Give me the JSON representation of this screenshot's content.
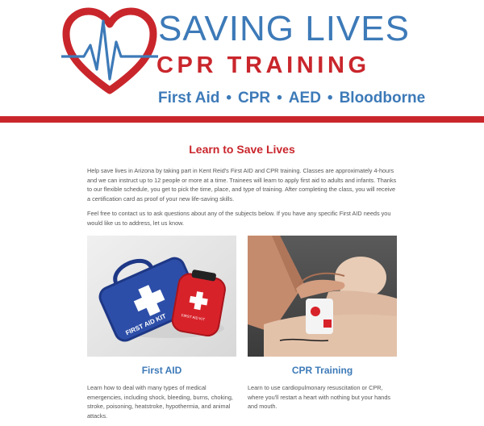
{
  "brand": {
    "title": "SAVING LIVES",
    "subtitle": "CPR TRAINING",
    "tagline": [
      "First Aid",
      "CPR",
      "AED",
      "Bloodborne"
    ],
    "tagline_separator": "•",
    "colors": {
      "blue": "#3d7ab8",
      "red": "#c9262c"
    },
    "logo_icon": "heart-heartbeat-icon"
  },
  "intro": {
    "title": "Learn to Save Lives",
    "paragraphs": [
      "Help save lives in Arizona by taking part in Kent Reid's First AID and CPR training. Classes are approximately 4-hours and we can instruct up to 12 people or more at a time. Trainees will learn to apply first aid to adults and infants. Thanks to our flexible schedule, you get to pick the time, place, and type of training. After completing the class, you will receive a certification card as proof of your new life-saving skills.",
      "Feel free to contact us to ask questions about any of the subjects below. If you have any specific First AID needs you would like us to address, let us know."
    ]
  },
  "cards": [
    {
      "title": "First AID",
      "text": "Learn how to deal with many types of medical emergencies, including shock, bleeding, burns, choking, stroke, poisoning, heatstroke, hypothermia, and animal attacks.",
      "photo_kit_label": "FIRST AID KIT",
      "photo_pouch_label": "FIRST AID KIT"
    },
    {
      "title": "CPR Training",
      "text": "Learn to use cardiopulmonary resuscitation or CPR, where you'll restart a heart with nothing but your hands and mouth."
    }
  ]
}
